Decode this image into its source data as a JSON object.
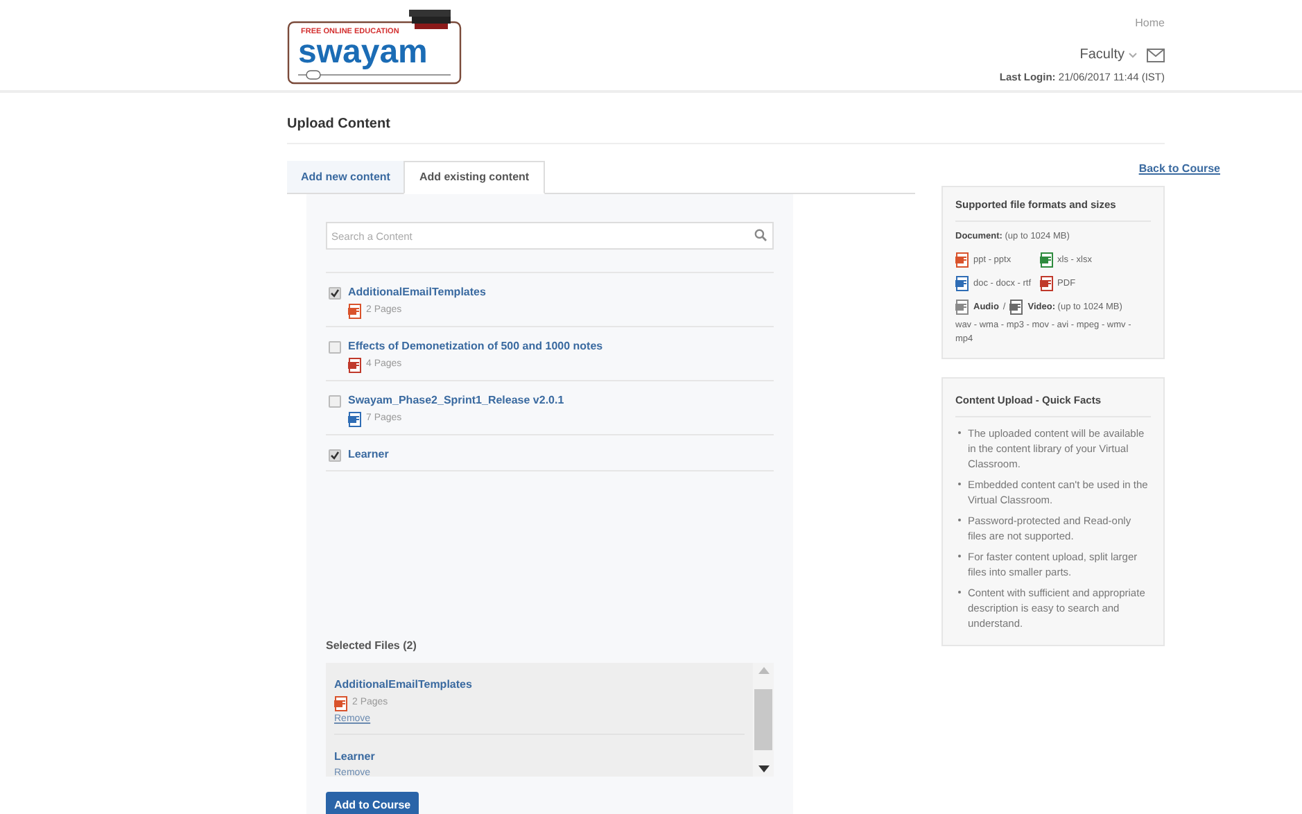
{
  "logo": {
    "tagline_top": "FREE ONLINE EDUCATION",
    "wordmark": "swayam"
  },
  "header": {
    "home": "Home",
    "user_menu": "Faculty",
    "last_login_label": "Last Login:",
    "last_login_value": "21/06/2017 11:44 (IST)"
  },
  "page_title": "Upload Content",
  "tabs": [
    {
      "label": "Add new content",
      "selected": false
    },
    {
      "label": "Add existing content",
      "selected": true
    }
  ],
  "back_link": "Back to Course",
  "search": {
    "placeholder": "Search a Content"
  },
  "content_items": [
    {
      "title": "AdditionalEmailTemplates",
      "checked": true,
      "kind": "ppt",
      "pages": "2 Pages"
    },
    {
      "title": "Effects of Demonetization of 500 and 1000 notes",
      "checked": false,
      "kind": "pdf",
      "pages": "4 Pages"
    },
    {
      "title": "Swayam_Phase2_Sprint1_Release v2.0.1",
      "checked": false,
      "kind": "doc",
      "pages": "7 Pages"
    },
    {
      "title": "Learner",
      "checked": true
    }
  ],
  "selected_files": {
    "heading": "Selected Files (2)",
    "items": [
      {
        "title": "AdditionalEmailTemplates",
        "kind": "ppt",
        "pages": "2 Pages",
        "remove": "Remove"
      },
      {
        "title": "Learner",
        "remove": "Remove"
      }
    ]
  },
  "add_button": "Add to Course",
  "formats_panel": {
    "title": "Supported file formats and sizes",
    "document_label": "Document:",
    "document_size": "(up to 1024 MB)",
    "formats": [
      {
        "kind": "ppt",
        "label": "ppt - pptx"
      },
      {
        "kind": "xls",
        "label": "xls - xlsx"
      },
      {
        "kind": "doc",
        "label": "doc - docx - rtf"
      },
      {
        "kind": "pdf",
        "label": "PDF"
      }
    ],
    "audio_label": "Audio",
    "separator": "/",
    "video_label": "Video:",
    "media_size": "(up to 1024 MB)",
    "media_formats": "wav - wma - mp3 - mov - avi - mpeg - wmv - mp4"
  },
  "facts_panel": {
    "title": "Content Upload - Quick Facts",
    "items": [
      "The uploaded content will be available in the content library of your Virtual Classroom.",
      "Embedded content can't be used in the Virtual Classroom.",
      "Password-protected and Read-only files are not supported.",
      "For faster content upload, split larger files into smaller parts.",
      "Content with sufficient and appropriate description is easy to search and understand."
    ]
  }
}
